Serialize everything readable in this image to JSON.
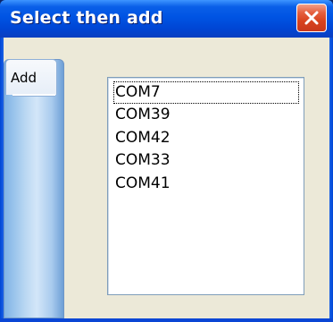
{
  "window": {
    "title": "Select then add"
  },
  "icons": {
    "close": "close-icon"
  },
  "colors": {
    "title_bar": "#0054e3",
    "close_button": "#d9441f",
    "client_background": "#ece9d8",
    "listbox_border": "#7f9db9"
  },
  "tabs": [
    {
      "label": "Add",
      "selected": true
    }
  ],
  "ports": {
    "focused_index": 0,
    "items": [
      "COM7",
      "COM39",
      "COM42",
      "COM33",
      "COM41"
    ]
  }
}
